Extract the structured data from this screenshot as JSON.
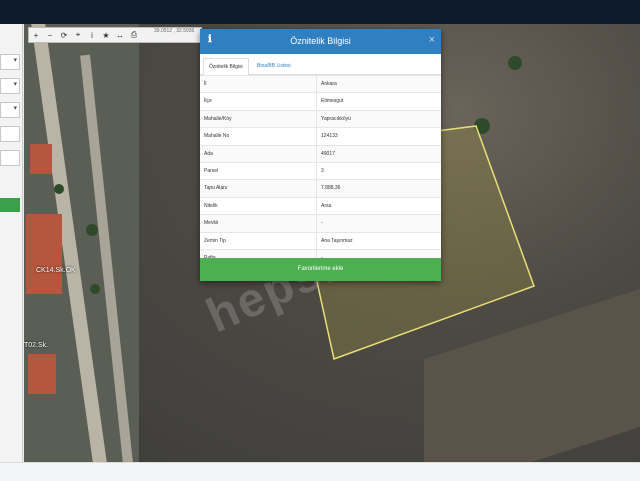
{
  "toolbar": {
    "tools": [
      "+",
      "−",
      "⟳",
      "⌖",
      "i",
      "★",
      "↔",
      "⎙"
    ],
    "icons": [
      "zoom-in-icon",
      "zoom-out-icon",
      "refresh-icon",
      "locate-icon",
      "info-icon",
      "star-icon",
      "measure-icon",
      "print-icon"
    ],
    "coords": "39.0512 , 32.5936"
  },
  "map": {
    "labels": [
      "CK14.Sk.OK",
      "T02.Sk."
    ],
    "watermark": "hepsi"
  },
  "dialog": {
    "title": "Öznitelik Bilgisi",
    "tabs": [
      "Öznitelik Bilgisi",
      "Bina/BB Listesi"
    ],
    "rows": [
      {
        "key": "İl",
        "value": "Ankara"
      },
      {
        "key": "İlçe",
        "value": "Etimesgut"
      },
      {
        "key": "Mahalle/Köy",
        "value": "Yapracıkköyü"
      },
      {
        "key": "Mahalle No",
        "value": "124133"
      },
      {
        "key": "Ada",
        "value": "49017"
      },
      {
        "key": "Parsel",
        "value": "3"
      },
      {
        "key": "Tapu Alanı",
        "value": "7.888,36"
      },
      {
        "key": "Nitelik",
        "value": "Arsa"
      },
      {
        "key": "Mevkii",
        "value": "-"
      },
      {
        "key": "Zemin Tip",
        "value": "Ana Taşınmaz"
      },
      {
        "key": "Pafta",
        "value": "-"
      }
    ],
    "favorite_button": "Favorilerime ekle"
  },
  "colors": {
    "header": "#2f7fc1",
    "favorite": "#4caf50",
    "parcel_outline": "#e8df78"
  }
}
